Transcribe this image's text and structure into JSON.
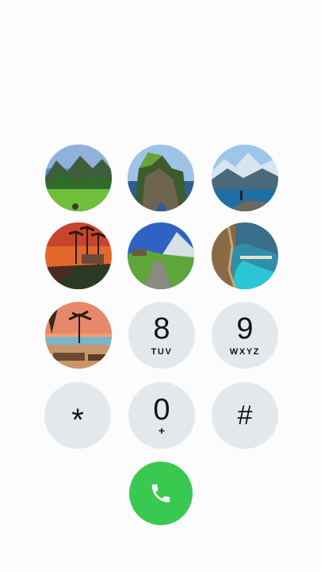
{
  "keypad": {
    "photo_keys": [
      {
        "scene": "green-meadow-mountains"
      },
      {
        "scene": "sea-cliff-arch"
      },
      {
        "scene": "alpine-lake"
      },
      {
        "scene": "sunset-palms-road"
      },
      {
        "scene": "mountain-trail"
      },
      {
        "scene": "resort-pool"
      },
      {
        "scene": "beach-sunset-palm"
      }
    ],
    "keys": {
      "k8": {
        "digit": "8",
        "letters": "TUV"
      },
      "k9": {
        "digit": "9",
        "letters": "WXYZ"
      },
      "star": {
        "digit": "*"
      },
      "k0": {
        "digit": "0",
        "sub": "+"
      },
      "hash": {
        "digit": "#"
      }
    }
  },
  "call_button": {
    "icon": "phone-icon",
    "color": "#39c950"
  },
  "colors": {
    "key_background": "#e4e8ec",
    "page_background": "#fcfcfd"
  }
}
